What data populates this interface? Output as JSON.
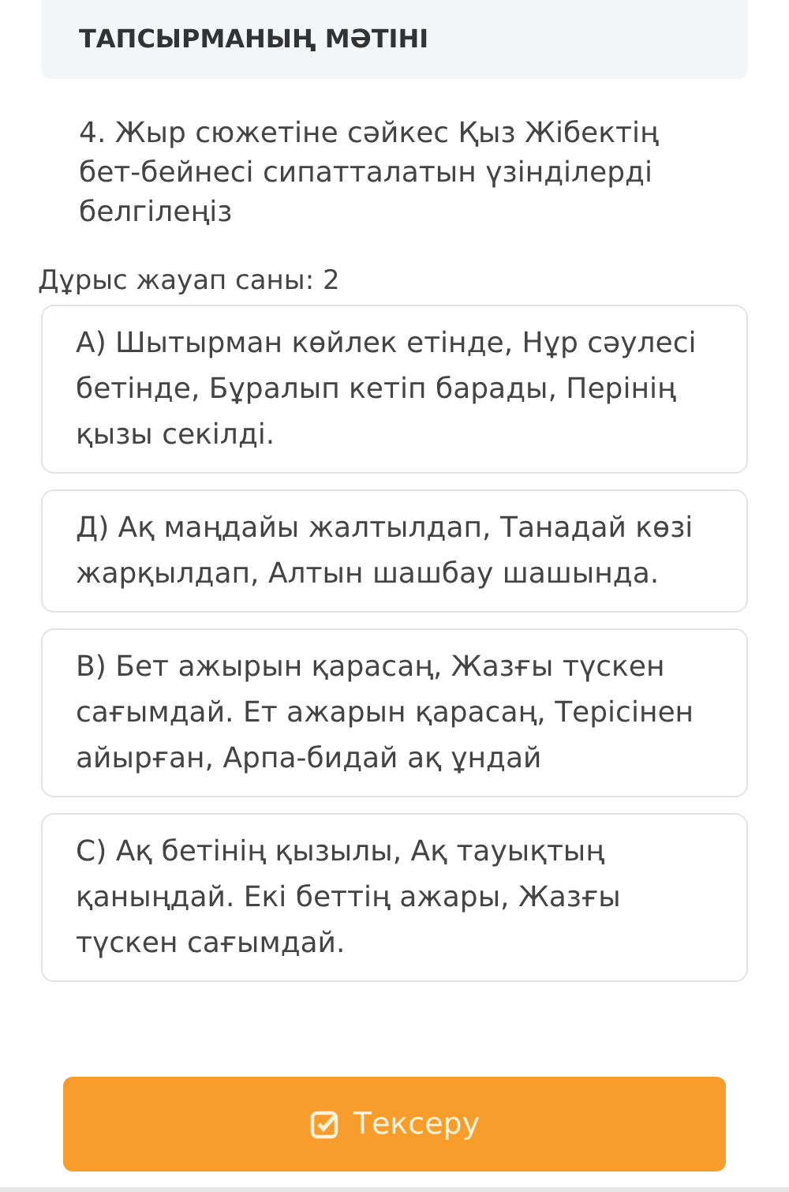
{
  "header": {
    "title": "ТАПСЫРМАНЫҢ МӘТІНІ"
  },
  "question": {
    "number": "4.",
    "text": "Жыр сюжетіне сәйкес Қыз Жібектің бет-бейнесі сипатталатын үзінділерді белгілеңіз"
  },
  "answer_count": "Дұрыс жауап саны: 2",
  "options": [
    {
      "text": "А) Шытырман көйлек етінде, Нұр сәулесі бетінде, Бұралып кетіп барады, Перінің қызы секілді."
    },
    {
      "text": "Д) Ақ маңдайы жалтылдап, Танадай көзі жарқылдап, Алтын шашбау шашында."
    },
    {
      "text": "В) Бет ажырын қарасаң, Жазғы түскен сағымдай. Ет ажарын қарасаң, Терісінен айырған, Арпа-бидай ақ ұндай"
    },
    {
      "text": "С) Ақ бетінің қызылы, Ақ тауықтың қаныңдай. Екі беттің ажары, Жазғы түскен сағымдай."
    }
  ],
  "submit_button": {
    "label": "Тексеру"
  }
}
